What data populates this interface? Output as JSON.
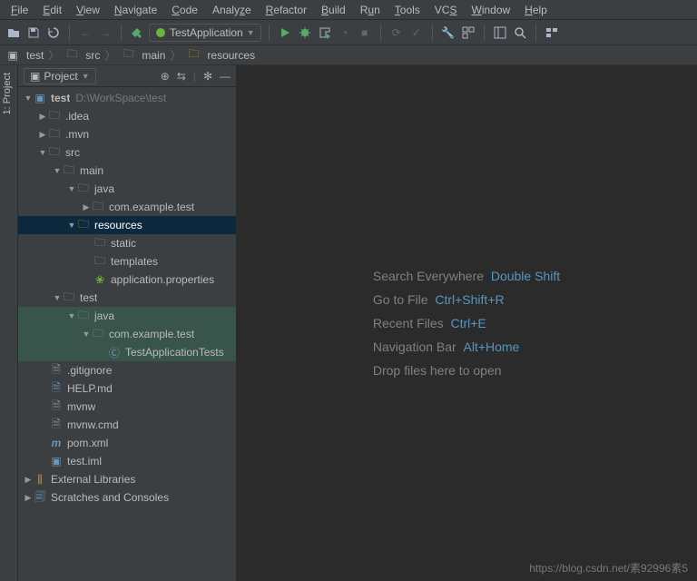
{
  "menu": [
    "File",
    "Edit",
    "View",
    "Navigate",
    "Code",
    "Analyze",
    "Refactor",
    "Build",
    "Run",
    "Tools",
    "VCS",
    "Window",
    "Help"
  ],
  "runConfig": {
    "label": "TestApplication"
  },
  "breadcrumb": [
    "test",
    "src",
    "main",
    "resources"
  ],
  "panel": {
    "title": "Project"
  },
  "tree": {
    "root": {
      "name": "test",
      "path": "D:\\WorkSpace\\test"
    },
    "idea": ".idea",
    "mvn": ".mvn",
    "src": "src",
    "main": "main",
    "java_main": "java",
    "pkg_main": "com.example.test",
    "resources": "resources",
    "static": "static",
    "templates": "templates",
    "appprops": "application.properties",
    "test": "test",
    "java_test": "java",
    "pkg_test": "com.example.test",
    "test_class": "TestApplicationTests",
    "gitignore": ".gitignore",
    "help": "HELP.md",
    "mvnw": "mvnw",
    "mvnwcmd": "mvnw.cmd",
    "pom": "pom.xml",
    "iml": "test.iml",
    "extlib": "External Libraries",
    "scratch": "Scratches and Consoles"
  },
  "hints": {
    "search": {
      "label": "Search Everywhere",
      "key": "Double Shift"
    },
    "goto": {
      "label": "Go to File",
      "key": "Ctrl+Shift+R"
    },
    "recent": {
      "label": "Recent Files",
      "key": "Ctrl+E"
    },
    "nav": {
      "label": "Navigation Bar",
      "key": "Alt+Home"
    },
    "drop": {
      "label": "Drop files here to open"
    }
  },
  "watermark": "https://blog.csdn.net/素92996素5",
  "gutter": "1: Project"
}
